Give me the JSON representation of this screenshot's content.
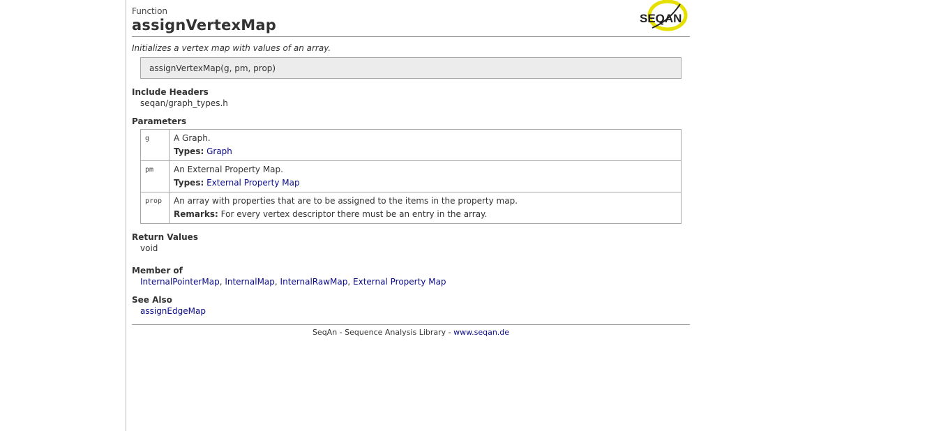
{
  "header": {
    "kind": "Function",
    "title": "assignVertexMap",
    "logo_text": "SEQAN"
  },
  "summary": "Initializes a vertex map with values of an array.",
  "signature": "assignVertexMap(g, pm, prop)",
  "include": {
    "title": "Include Headers",
    "file": "seqan/graph_types.h"
  },
  "parameters": {
    "title": "Parameters",
    "rows": [
      {
        "name": "g",
        "desc": "A Graph.",
        "label": "Types:",
        "value": "Graph",
        "is_link": true
      },
      {
        "name": "pm",
        "desc": "An External Property Map.",
        "label": "Types:",
        "value": "External Property Map",
        "is_link": true
      },
      {
        "name": "prop",
        "desc": "An array with properties that are to be assigned to the items in the property map.",
        "label": "Remarks:",
        "value": "For every vertex descriptor there must be an entry in the array.",
        "is_link": false
      }
    ]
  },
  "return_values": {
    "title": "Return Values",
    "value": "void"
  },
  "member_of": {
    "title": "Member of",
    "links": [
      "InternalPointerMap",
      "InternalMap",
      "InternalRawMap",
      "External Property Map"
    ],
    "sep": ", "
  },
  "see_also": {
    "title": "See Also",
    "link": "assignEdgeMap"
  },
  "footer": {
    "text": "SeqAn - Sequence Analysis Library - ",
    "link": "www.seqan.de"
  },
  "colors": {
    "link": "#0a0a8a",
    "logo_yellow": "#e5e000",
    "rule": "#9a9a9a",
    "signature_bg": "#ececec"
  }
}
